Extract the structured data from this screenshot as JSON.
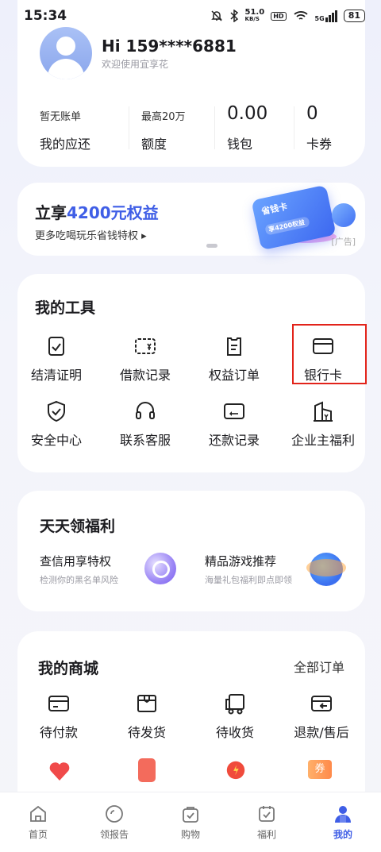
{
  "status_bar": {
    "time": "15:34",
    "net_speed": "51.0",
    "net_unit": "KB/S",
    "hd": "HD",
    "signal": "5G",
    "battery": "81"
  },
  "profile": {
    "greeting": "Hi 159****6881",
    "welcome": "欢迎使用宜享花"
  },
  "stats": [
    {
      "top": "暂无账单",
      "bottom": "我的应还"
    },
    {
      "top": "最高20万",
      "bottom": "额度"
    },
    {
      "top": "0.00",
      "bottom": "钱包"
    },
    {
      "top": "0",
      "bottom": "卡券"
    }
  ],
  "ad": {
    "title_prefix": "立享",
    "title_highlight": "4200元权益",
    "subtitle": "更多吃喝玩乐省钱特权",
    "card_title": "省钱卡",
    "card_badge": "享4200权益",
    "tag": "[广告]"
  },
  "tools": {
    "title": "我的工具",
    "items": [
      {
        "label": "结清证明",
        "icon": "document-check-icon"
      },
      {
        "label": "借款记录",
        "icon": "loan-record-icon"
      },
      {
        "label": "权益订单",
        "icon": "benefit-order-icon"
      },
      {
        "label": "银行卡",
        "icon": "bank-card-icon"
      },
      {
        "label": "安全中心",
        "icon": "shield-check-icon"
      },
      {
        "label": "联系客服",
        "icon": "headset-icon"
      },
      {
        "label": "还款记录",
        "icon": "repayment-record-icon"
      },
      {
        "label": "企业主福利",
        "icon": "enterprise-icon"
      }
    ]
  },
  "welfare": {
    "title": "天天领福利",
    "items": [
      {
        "title": "查信用享特权",
        "subtitle": "检测你的黑名单风险"
      },
      {
        "title": "精品游戏推荐",
        "subtitle": "海量礼包福利即点即领"
      }
    ]
  },
  "mall": {
    "title": "我的商城",
    "all_orders": "全部订单",
    "items": [
      {
        "label": "待付款",
        "icon": "wallet-card-icon"
      },
      {
        "label": "待发货",
        "icon": "package-icon"
      },
      {
        "label": "待收货",
        "icon": "truck-icon"
      },
      {
        "label": "退款/售后",
        "icon": "refund-icon"
      }
    ],
    "colored_icons": [
      "heart-icon",
      "phone-icon",
      "alarm-clock-icon",
      "coupon-icon"
    ],
    "coupon_char": "券",
    "colors": [
      "#f04a4a",
      "#f06a5a",
      "#f05040",
      "#ff9a5a"
    ]
  },
  "tabbar": [
    {
      "label": "首页",
      "icon": "home-icon",
      "active": false
    },
    {
      "label": "领报告",
      "icon": "report-icon",
      "active": false
    },
    {
      "label": "购物",
      "icon": "shopping-bag-icon",
      "active": false
    },
    {
      "label": "福利",
      "icon": "welfare-calendar-icon",
      "active": false
    },
    {
      "label": "我的",
      "icon": "profile-icon",
      "active": true
    }
  ],
  "accent": "#3f5ee6",
  "highlight_color": "#e2231a"
}
